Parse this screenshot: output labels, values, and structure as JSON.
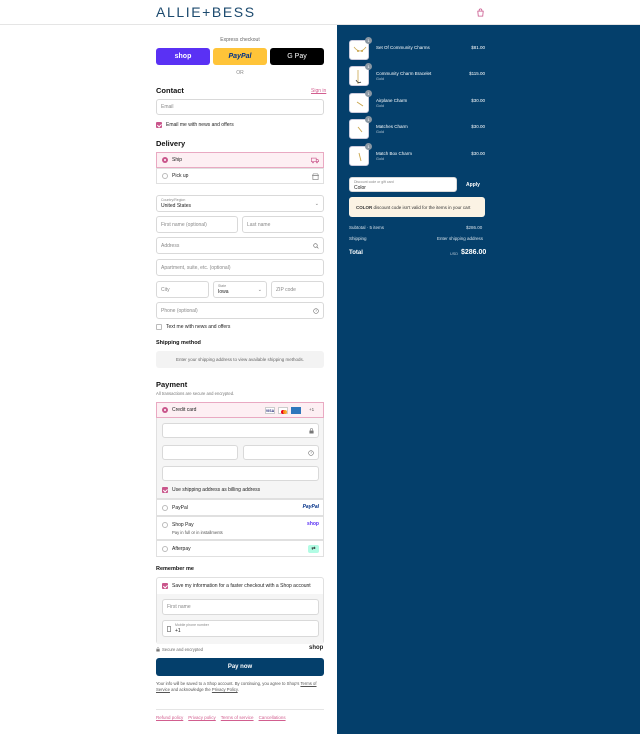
{
  "brand": {
    "logo": "ALLIE+BESS",
    "accent": "#c9558b",
    "navy": "#043f6b"
  },
  "express": {
    "label": "Express checkout",
    "shop": "shop",
    "paypal": "PayPal",
    "gpay": "G Pay",
    "or": "OR"
  },
  "contact": {
    "title": "Contact",
    "sign_in": "Sign in",
    "email_placeholder": "Email",
    "news_label": "Email me with news and offers"
  },
  "delivery": {
    "title": "Delivery",
    "ship_label": "Ship",
    "pickup_label": "Pick up",
    "country_label": "Country/Region",
    "country_value": "United States",
    "first_name": "First name (optional)",
    "last_name": "Last name",
    "address": "Address",
    "apartment": "Apartment, suite, etc. (optional)",
    "city": "City",
    "state_label": "State",
    "state_value": "Iowa",
    "zip": "ZIP code",
    "phone": "Phone (optional)",
    "text_label": "Text me with news and offers"
  },
  "shipping": {
    "title": "Shipping method",
    "message": "Enter your shipping address to view available shipping methods."
  },
  "payment": {
    "title": "Payment",
    "subtitle": "All transactions are secure and encrypted.",
    "credit_label": "Credit card",
    "card_plus": "+1",
    "billing_label": "Use shipping address as billing address",
    "paypal_label": "PayPal",
    "paypal_logo": "PayPal",
    "shoppay_label": "Shop Pay",
    "shoppay_sub": "Pay in full or in installments",
    "shoppay_logo": "shop",
    "afterpay_label": "Afterpay"
  },
  "remember": {
    "title": "Remember me",
    "save_label": "Save my information for a faster checkout with a Shop account",
    "first_name": "First name",
    "mobile_label": "Mobile phone number",
    "mobile_value": "+1",
    "secure": "Secure and encrypted",
    "shop_logo": "shop"
  },
  "pay_now": "Pay now",
  "legal": {
    "line1": "Your info will be saved to a Shop account. By continuing, you agree to Shop's",
    "tos": "Terms of Service",
    "mid": "and acknowledge the",
    "privacy": "Privacy Policy",
    "end": "."
  },
  "footer": [
    "Refund policy",
    "Privacy policy",
    "Terms of service",
    "Cancellations"
  ],
  "cart": {
    "items": [
      {
        "name": "Set Of Community Charms",
        "variant": "",
        "price": "$81.00",
        "qty": "1"
      },
      {
        "name": "Community Charm Bracelet",
        "variant": "Gold",
        "price": "$115.00",
        "qty": "1"
      },
      {
        "name": "Airplane Charm",
        "variant": "Gold",
        "price": "$30.00",
        "qty": "1"
      },
      {
        "name": "Matches Charm",
        "variant": "Gold",
        "price": "$30.00",
        "qty": "1"
      },
      {
        "name": "Match Box Charm",
        "variant": "Gold",
        "price": "$30.00",
        "qty": "1"
      }
    ],
    "discount_label": "Discount code or gift card",
    "discount_value": "Color",
    "apply": "Apply",
    "warning_code": "COLOR",
    "warning_text": "discount code isn't valid for the items in your cart",
    "subtotal_label": "Subtotal · 5 items",
    "subtotal_value": "$286.00",
    "shipping_label": "Shipping",
    "shipping_value": "Enter shipping address",
    "total_label": "Total",
    "currency": "USD",
    "total_value": "$286.00"
  }
}
